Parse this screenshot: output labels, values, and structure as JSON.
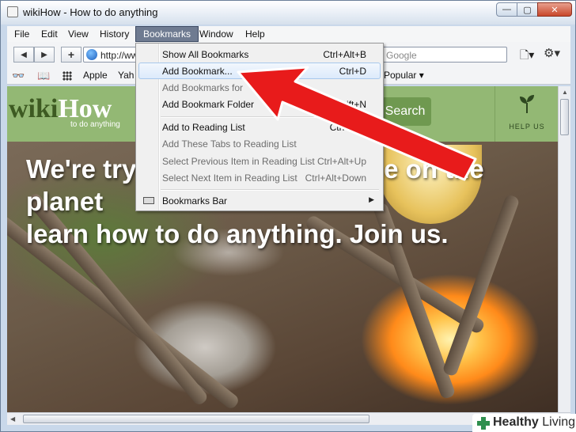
{
  "window": {
    "title": "wikiHow - How to do anything",
    "min_glyph": "—",
    "max_glyph": "▢",
    "close_glyph": "✕"
  },
  "menubar": {
    "items": [
      "File",
      "Edit",
      "View",
      "History",
      "Bookmarks",
      "Window",
      "Help"
    ],
    "active": "Bookmarks"
  },
  "navbar": {
    "back_glyph": "◀",
    "forward_glyph": "▶",
    "add_glyph": "+",
    "url_text": "http://ww",
    "search_placeholder": "Google",
    "page_menu_glyph": "🗋▾",
    "settings_glyph": "⚙▾"
  },
  "bookmarks_bar": {
    "reading_glasses_glyph": "👓",
    "book_glyph": "📖",
    "items": [
      "Apple",
      "Yah",
      "Popular ▾"
    ]
  },
  "bookmarks_menu": {
    "items": [
      {
        "label": "Show All Bookmarks",
        "shortcut": "Ctrl+Alt+B",
        "enabled": true,
        "highlighted": false
      },
      {
        "label": "Add Bookmark...",
        "shortcut": "Ctrl+D",
        "enabled": true,
        "highlighted": true
      },
      {
        "label": "Add Bookmarks for",
        "shortcut": "",
        "enabled": false,
        "highlighted": false
      },
      {
        "label": "Add Bookmark Folder",
        "shortcut": "trl+Shift+N",
        "enabled": true,
        "highlighted": false
      },
      {
        "label": "Add to Reading List",
        "shortcut": "Ctrl+Shif",
        "enabled": true,
        "highlighted": false
      },
      {
        "label": "Add These Tabs to Reading List",
        "shortcut": "",
        "enabled": false,
        "highlighted": false
      },
      {
        "label": "Select Previous Item in Reading List",
        "shortcut": "Ctrl+Alt+Up",
        "enabled": false,
        "highlighted": false
      },
      {
        "label": "Select Next Item in Reading List",
        "shortcut": "Ctrl+Alt+Down",
        "enabled": false,
        "highlighted": false
      },
      {
        "label": "Bookmarks Bar",
        "shortcut": "",
        "enabled": true,
        "highlighted": false
      }
    ],
    "bmbar_submenu_glyph": "▶"
  },
  "page": {
    "logo_wiki": "wiki",
    "logo_how": "How",
    "tagline": "to do anything",
    "search_button": "Search",
    "help_us": "HELP US",
    "headline_line1": "We're try",
    "headline_line1_end": "ne on the",
    "headline_line2": "planet",
    "headline_line3": "learn how to do anything. Join us."
  },
  "watermark": {
    "brand_bold": "Healthy",
    "brand_light": " Living"
  },
  "colors": {
    "wikihow_green": "#93b874",
    "arrow_red": "#e81b1b",
    "menu_highlight": "#dceafb"
  }
}
